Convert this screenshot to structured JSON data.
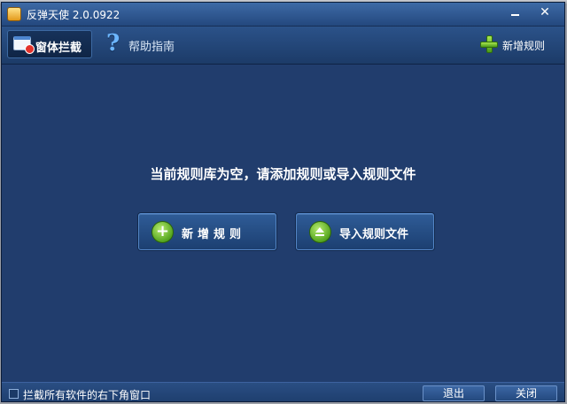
{
  "window": {
    "title": "反弹天使 2.0.0922",
    "minimize_icon": "minimize-icon",
    "close_glyph": "✕"
  },
  "toolbar": {
    "tab_active_label": "窗体拦截",
    "help_label": "帮助指南",
    "help_glyph": "?",
    "new_rule_label": "新增规则"
  },
  "content": {
    "empty_message": "当前规则库为空，请添加规则或导入规则文件",
    "new_rule_button": "新增规则",
    "import_button": "导入规则文件",
    "plus_glyph": "+"
  },
  "statusbar": {
    "checkbox_label": "拦截所有软件的右下角窗口",
    "checkbox_checked": false,
    "exit_button": "退出",
    "close_button": "关闭"
  },
  "colors": {
    "accent": "#213d6d",
    "button_green": "#55a51f"
  }
}
